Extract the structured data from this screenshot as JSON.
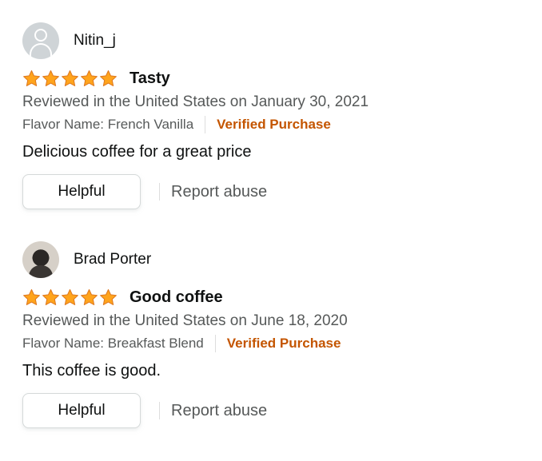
{
  "colors": {
    "star_fill": "#ffa41c",
    "star_stroke": "#de7921",
    "verified": "#c45500",
    "secondary_text": "#565959",
    "primary_text": "#0f1111"
  },
  "reviews": [
    {
      "profile_name": "Nitin_j",
      "avatar": "default-user-icon",
      "rating": 5,
      "title": "Tasty",
      "date": "Reviewed in the United States on January 30, 2021",
      "flavor": "Flavor Name: French Vanilla",
      "verified": "Verified Purchase",
      "body": "Delicious coffee for a great price",
      "helpful_label": "Helpful",
      "report_label": "Report abuse"
    },
    {
      "profile_name": "Brad Porter",
      "avatar": "user-photo",
      "rating": 5,
      "title": "Good coffee",
      "date": "Reviewed in the United States on June 18, 2020",
      "flavor": "Flavor Name: Breakfast Blend",
      "verified": "Verified Purchase",
      "body": "This coffee is good.",
      "helpful_label": "Helpful",
      "report_label": "Report abuse"
    }
  ]
}
